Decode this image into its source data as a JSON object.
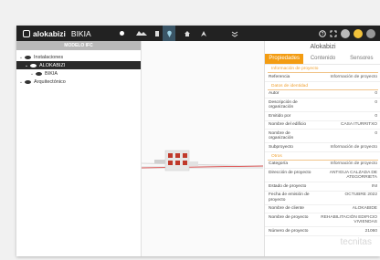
{
  "topbar": {
    "brand": "alokabizi",
    "project": "BIKIA",
    "icons": [
      "moon-icon",
      "visor-icon",
      "layers-icon",
      "pin-icon",
      "home-icon",
      "collapse-icon",
      "help-icon",
      "fullscreen-icon"
    ],
    "accent": "#3a5566"
  },
  "left_panel": {
    "header": "MODELO IFC",
    "tree": [
      {
        "label": "Instalaciones",
        "level": 0,
        "expanded": true
      },
      {
        "label": "ALOKABIZI",
        "level": 1,
        "expanded": true,
        "selected": true
      },
      {
        "label": "BIKIA",
        "level": 2,
        "expanded": true
      },
      {
        "label": "Arquitectónico",
        "level": 0,
        "expanded": true
      }
    ]
  },
  "right_panel": {
    "title": "Alokabizi",
    "tabs": [
      "Propiedades",
      "Contenido",
      "Sensores"
    ],
    "active_tab": "Propiedades",
    "sections": [
      {
        "title": "Información de proyecto",
        "rows": [
          {
            "k": "Referencia",
            "v": "Información de proyecto"
          }
        ]
      },
      {
        "title": "Datos de identidad",
        "rows": [
          {
            "k": "Autor",
            "v": "0"
          },
          {
            "k": "Descripción de organización",
            "v": "0"
          },
          {
            "k": "Emitido por",
            "v": "0"
          },
          {
            "k": "Nombre del edificio",
            "v": "CASA ITURRITXO"
          },
          {
            "k": "Nombre de organización",
            "v": "0"
          },
          {
            "k": "Subproyecto",
            "v": "Información de proyecto"
          }
        ]
      },
      {
        "title": "Otros",
        "rows": [
          {
            "k": "Categoría",
            "v": "Información de proyecto"
          },
          {
            "k": "Dirección de proyecto",
            "v": "ANTIGUA CALZADA DE ATEGORRIETA"
          },
          {
            "k": "Estado de proyecto",
            "v": "INI"
          },
          {
            "k": "Fecha de emisión de proyecto",
            "v": "OCTUBRE 2022"
          },
          {
            "k": "Nombre de cliente",
            "v": "ALOKABIDE"
          },
          {
            "k": "Nombre de proyecto",
            "v": "REHABILITACIÓN EDIFICIO VIVIENDAS"
          },
          {
            "k": "Número de proyecto",
            "v": "21060"
          }
        ]
      }
    ]
  },
  "watermark": "tecnitas"
}
